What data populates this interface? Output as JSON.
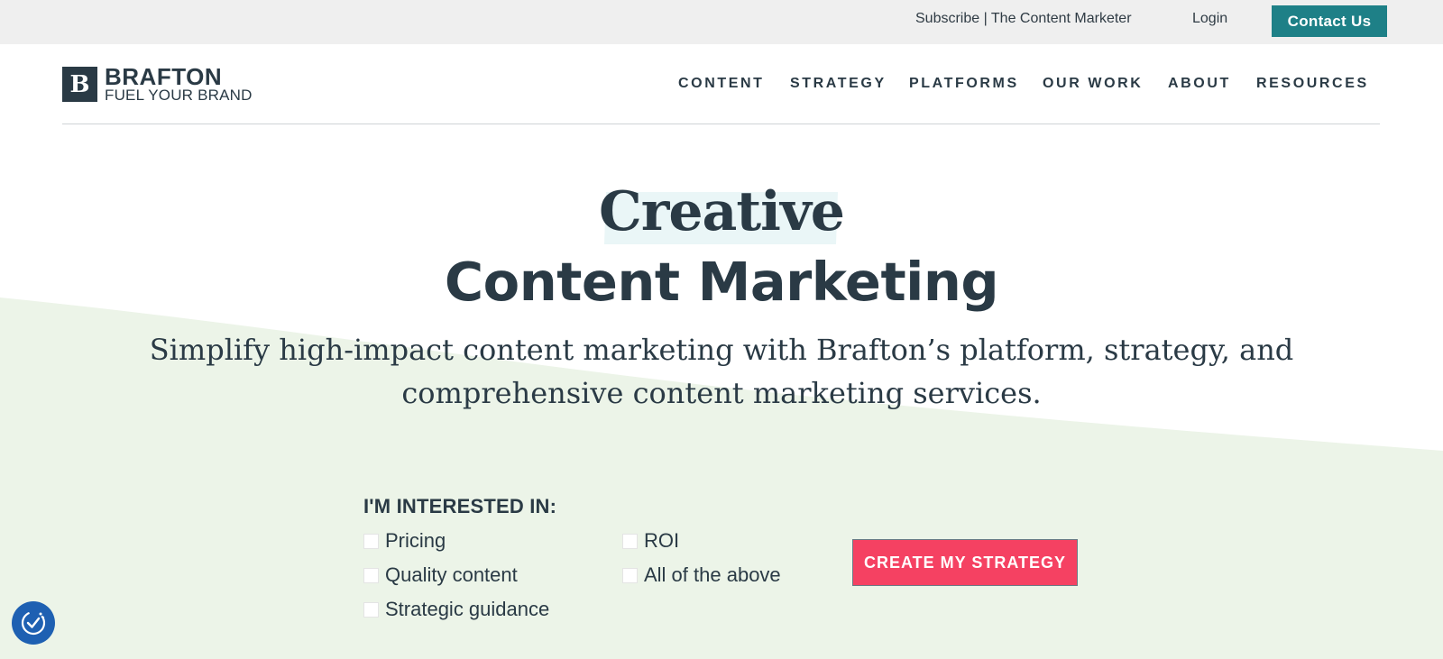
{
  "utility_bar": {
    "subscribe": "Subscribe | The Content Marketer",
    "login": "Login",
    "contact": "Contact Us"
  },
  "logo": {
    "mark": "B",
    "name": "BRAFTON",
    "tagline": "FUEL YOUR BRAND"
  },
  "nav": [
    "CONTENT",
    "STRATEGY",
    "PLATFORMS",
    "OUR WORK",
    "ABOUT",
    "RESOURCES"
  ],
  "hero": {
    "script_title": "Creative",
    "title": "Content Marketing",
    "subtitle": "Simplify high-impact content marketing with Brafton’s platform, strategy, and comprehensive content marketing services."
  },
  "form": {
    "label": "I'M INTERESTED IN:",
    "options": [
      "Pricing",
      "Quality content",
      "Strategic guidance",
      "ROI",
      "All of the above"
    ],
    "cta": "CREATE MY STRATEGY"
  },
  "icons": {
    "cookie": "cookie-settings-icon"
  },
  "colors": {
    "brand_dark": "#2a3a45",
    "teal": "#1e8087",
    "cta_red": "#f54162",
    "wave": "#ecf4e8",
    "highlight": "#eaf6f7",
    "cookie_blue": "#1e60b2"
  }
}
